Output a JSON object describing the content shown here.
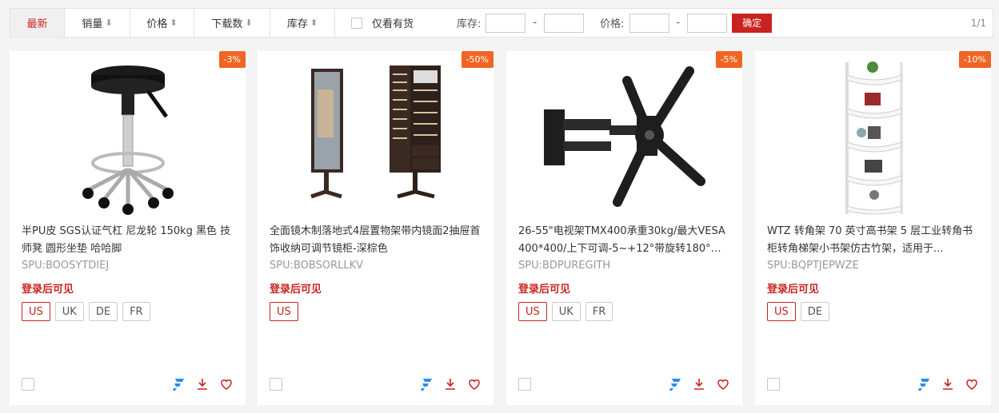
{
  "toolbar": {
    "sort_tabs": [
      {
        "label": "最新",
        "arrow": ""
      },
      {
        "label": "销量",
        "arrow": "⬇"
      },
      {
        "label": "价格",
        "arrow": "⬍"
      },
      {
        "label": "下载数",
        "arrow": "⬇"
      },
      {
        "label": "库存",
        "arrow": "⬍"
      }
    ],
    "instock_label": "仅看有货",
    "stock_label": "库存:",
    "price_label": "价格:",
    "dash": "-",
    "confirm_label": "确定",
    "pager": "1/1"
  },
  "products": [
    {
      "discount": "-3%",
      "title": "半PU皮 SGS认证气杠 尼龙轮 150kg 黑色 技师凳 圆形坐垫 哈哈脚",
      "spu": "SPU:BOOSYTDIEJ",
      "login_tip": "登录后可见",
      "sites": [
        "US",
        "UK",
        "DE",
        "FR"
      ]
    },
    {
      "discount": "-50%",
      "title": "全面镜木制落地式4层置物架带内镜面2抽屉首饰收纳可调节镜柜-深棕色",
      "spu": "SPU:BOBSORLLKV",
      "login_tip": "登录后可见",
      "sites": [
        "US"
      ]
    },
    {
      "discount": "-5%",
      "title": "26-55\"电视架TMX400承重30kg/最大VESA 400*400/上下可调-5~+12°带旋转180°带...",
      "spu": "SPU:BDPUREGITH",
      "login_tip": "登录后可见",
      "sites": [
        "US",
        "UK",
        "FR"
      ]
    },
    {
      "discount": "-10%",
      "title": "WTZ 转角架 70 英寸高书架 5 层工业转角书柜转角梯架小书架仿古竹架，适用于...",
      "spu": "SPU:BQPTJEPWZE",
      "login_tip": "登录后可见",
      "sites": [
        "US",
        "DE"
      ]
    }
  ],
  "colors": {
    "accent": "#c9231f",
    "discount": "#f16524",
    "brand_blue": "#2d8cf0"
  }
}
